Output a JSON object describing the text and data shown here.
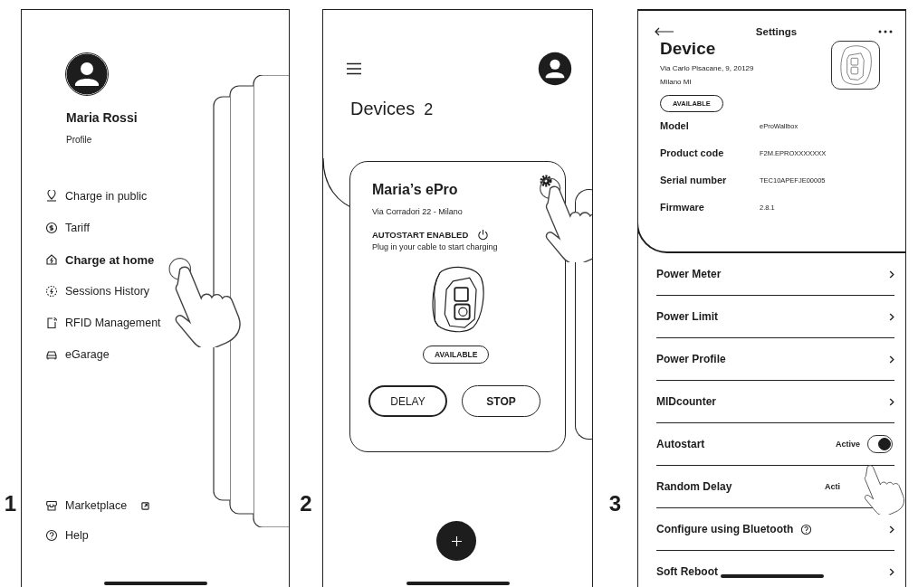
{
  "menu_screen": {
    "step": "1",
    "user": {
      "name": "Maria Rossi",
      "subtitle": "Profile"
    },
    "items": [
      {
        "label": "Charge in public",
        "selected": false
      },
      {
        "label": "Tariff",
        "selected": false
      },
      {
        "label": "Charge at home",
        "selected": true
      },
      {
        "label": "Sessions History",
        "selected": false
      },
      {
        "label": "RFID Management",
        "selected": false
      },
      {
        "label": "eGarage",
        "selected": false
      }
    ],
    "footer_items": [
      {
        "label": "Marketplace",
        "external": true
      },
      {
        "label": "Help",
        "external": false
      }
    ]
  },
  "devices_screen": {
    "step": "2",
    "title": "Devices",
    "count": "2",
    "card": {
      "name": "Maria’s ePro",
      "address": "Via Corradori 22 - Milano",
      "autostart": "AUTOSTART ENABLED",
      "hint": "Plug in your cable to start charging",
      "status": "AVAILABLE",
      "buttons": [
        {
          "label": "DELAY",
          "kind": "outline"
        },
        {
          "label": "STOP",
          "kind": "bold"
        }
      ]
    }
  },
  "settings_screen": {
    "step": "3",
    "title": "Settings",
    "device": {
      "heading": "Device",
      "address": [
        "Via Carlo Pisacane, 9, 20129",
        "Milano MI"
      ],
      "status": "AVAILABLE"
    },
    "info": [
      {
        "label": "Model",
        "value": "eProWallbox"
      },
      {
        "label": "Product code",
        "value": "F2M.EPROXXXXXXX"
      },
      {
        "label": "Serial number",
        "value": "TEC10APEFJE00005"
      },
      {
        "label": "Firmware",
        "value": "2.8.1"
      }
    ],
    "rows": [
      {
        "label": "Power Meter",
        "kind": "link"
      },
      {
        "label": "Power Limit",
        "kind": "link"
      },
      {
        "label": "Power Profile",
        "kind": "link"
      },
      {
        "label": "MIDcounter",
        "kind": "link"
      },
      {
        "label": "Autostart",
        "kind": "toggle",
        "value": "Active",
        "on": true
      },
      {
        "label": "Random Delay",
        "kind": "status",
        "value": "Acti"
      },
      {
        "label": "Configure using Bluetooth",
        "kind": "link",
        "help": true
      },
      {
        "label": "Soft Reboot",
        "kind": "link"
      }
    ]
  }
}
